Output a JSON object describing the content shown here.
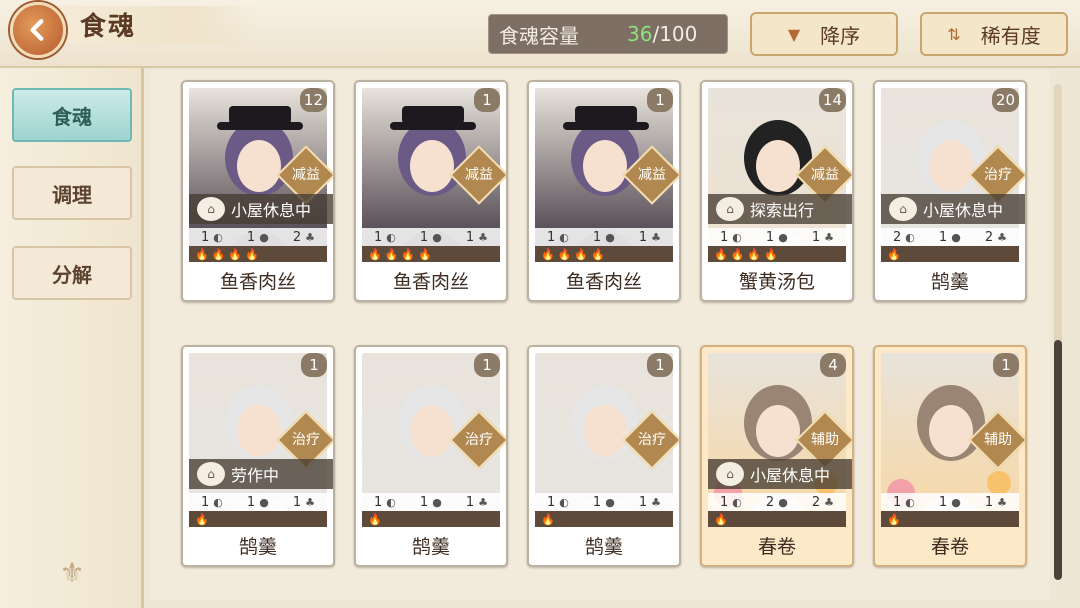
{
  "header": {
    "title": "食魂",
    "capacity_label": "食魂容量",
    "capacity_current": "36",
    "capacity_max": "/100",
    "sort_order_label": "降序",
    "sort_rarity_label": "稀有度"
  },
  "sidebar": {
    "items": [
      {
        "label": "食魂",
        "active": true
      },
      {
        "label": "调理",
        "active": false
      },
      {
        "label": "分解",
        "active": false
      }
    ]
  },
  "cards": [
    {
      "name": "鱼香肉丝",
      "level": "12",
      "role": "减益",
      "status": "小屋休息中",
      "stats": [
        "1",
        "1",
        "2"
      ],
      "flames": 4,
      "theme": "dark"
    },
    {
      "name": "鱼香肉丝",
      "level": "1",
      "role": "减益",
      "status": "",
      "stats": [
        "1",
        "1",
        "1"
      ],
      "flames": 4,
      "theme": "dark"
    },
    {
      "name": "鱼香肉丝",
      "level": "1",
      "role": "减益",
      "status": "",
      "stats": [
        "1",
        "1",
        "1"
      ],
      "flames": 4,
      "theme": "dark"
    },
    {
      "name": "蟹黄汤包",
      "level": "14",
      "role": "减益",
      "status": "探索出行",
      "stats": [
        "1",
        "1",
        "1"
      ],
      "flames": 4,
      "theme": "light"
    },
    {
      "name": "鹄羹",
      "level": "20",
      "role": "治疗",
      "status": "小屋休息中",
      "stats": [
        "2",
        "1",
        "2"
      ],
      "flames": 1,
      "theme": "white"
    },
    {
      "name": "鹄羹",
      "level": "1",
      "role": "治疗",
      "status": "劳作中",
      "stats": [
        "1",
        "1",
        "1"
      ],
      "flames": 1,
      "theme": "white"
    },
    {
      "name": "鹄羹",
      "level": "1",
      "role": "治疗",
      "status": "",
      "stats": [
        "1",
        "1",
        "1"
      ],
      "flames": 1,
      "theme": "white"
    },
    {
      "name": "鹄羹",
      "level": "1",
      "role": "治疗",
      "status": "",
      "stats": [
        "1",
        "1",
        "1"
      ],
      "flames": 1,
      "theme": "white"
    },
    {
      "name": "春卷",
      "level": "4",
      "role": "辅助",
      "status": "小屋休息中",
      "stats": [
        "1",
        "2",
        "2"
      ],
      "flames": 1,
      "theme": "orange"
    },
    {
      "name": "春卷",
      "level": "1",
      "role": "辅助",
      "status": "",
      "stats": [
        "1",
        "1",
        "1"
      ],
      "flames": 1,
      "theme": "orange"
    }
  ],
  "colors": {
    "dark_portrait": "#3a2e3b",
    "light_portrait": "#efe2cf",
    "white_portrait": "#e7e5e2",
    "orange_portrait": "#f8d7a2",
    "accent_green": "#8ee07c"
  },
  "icons": {
    "back": "chevron-left-icon",
    "sort_order": "triangle-down-icon",
    "sort_rarity": "sort-arrows-icon",
    "status": "house-icon",
    "flame": "flame-icon"
  }
}
